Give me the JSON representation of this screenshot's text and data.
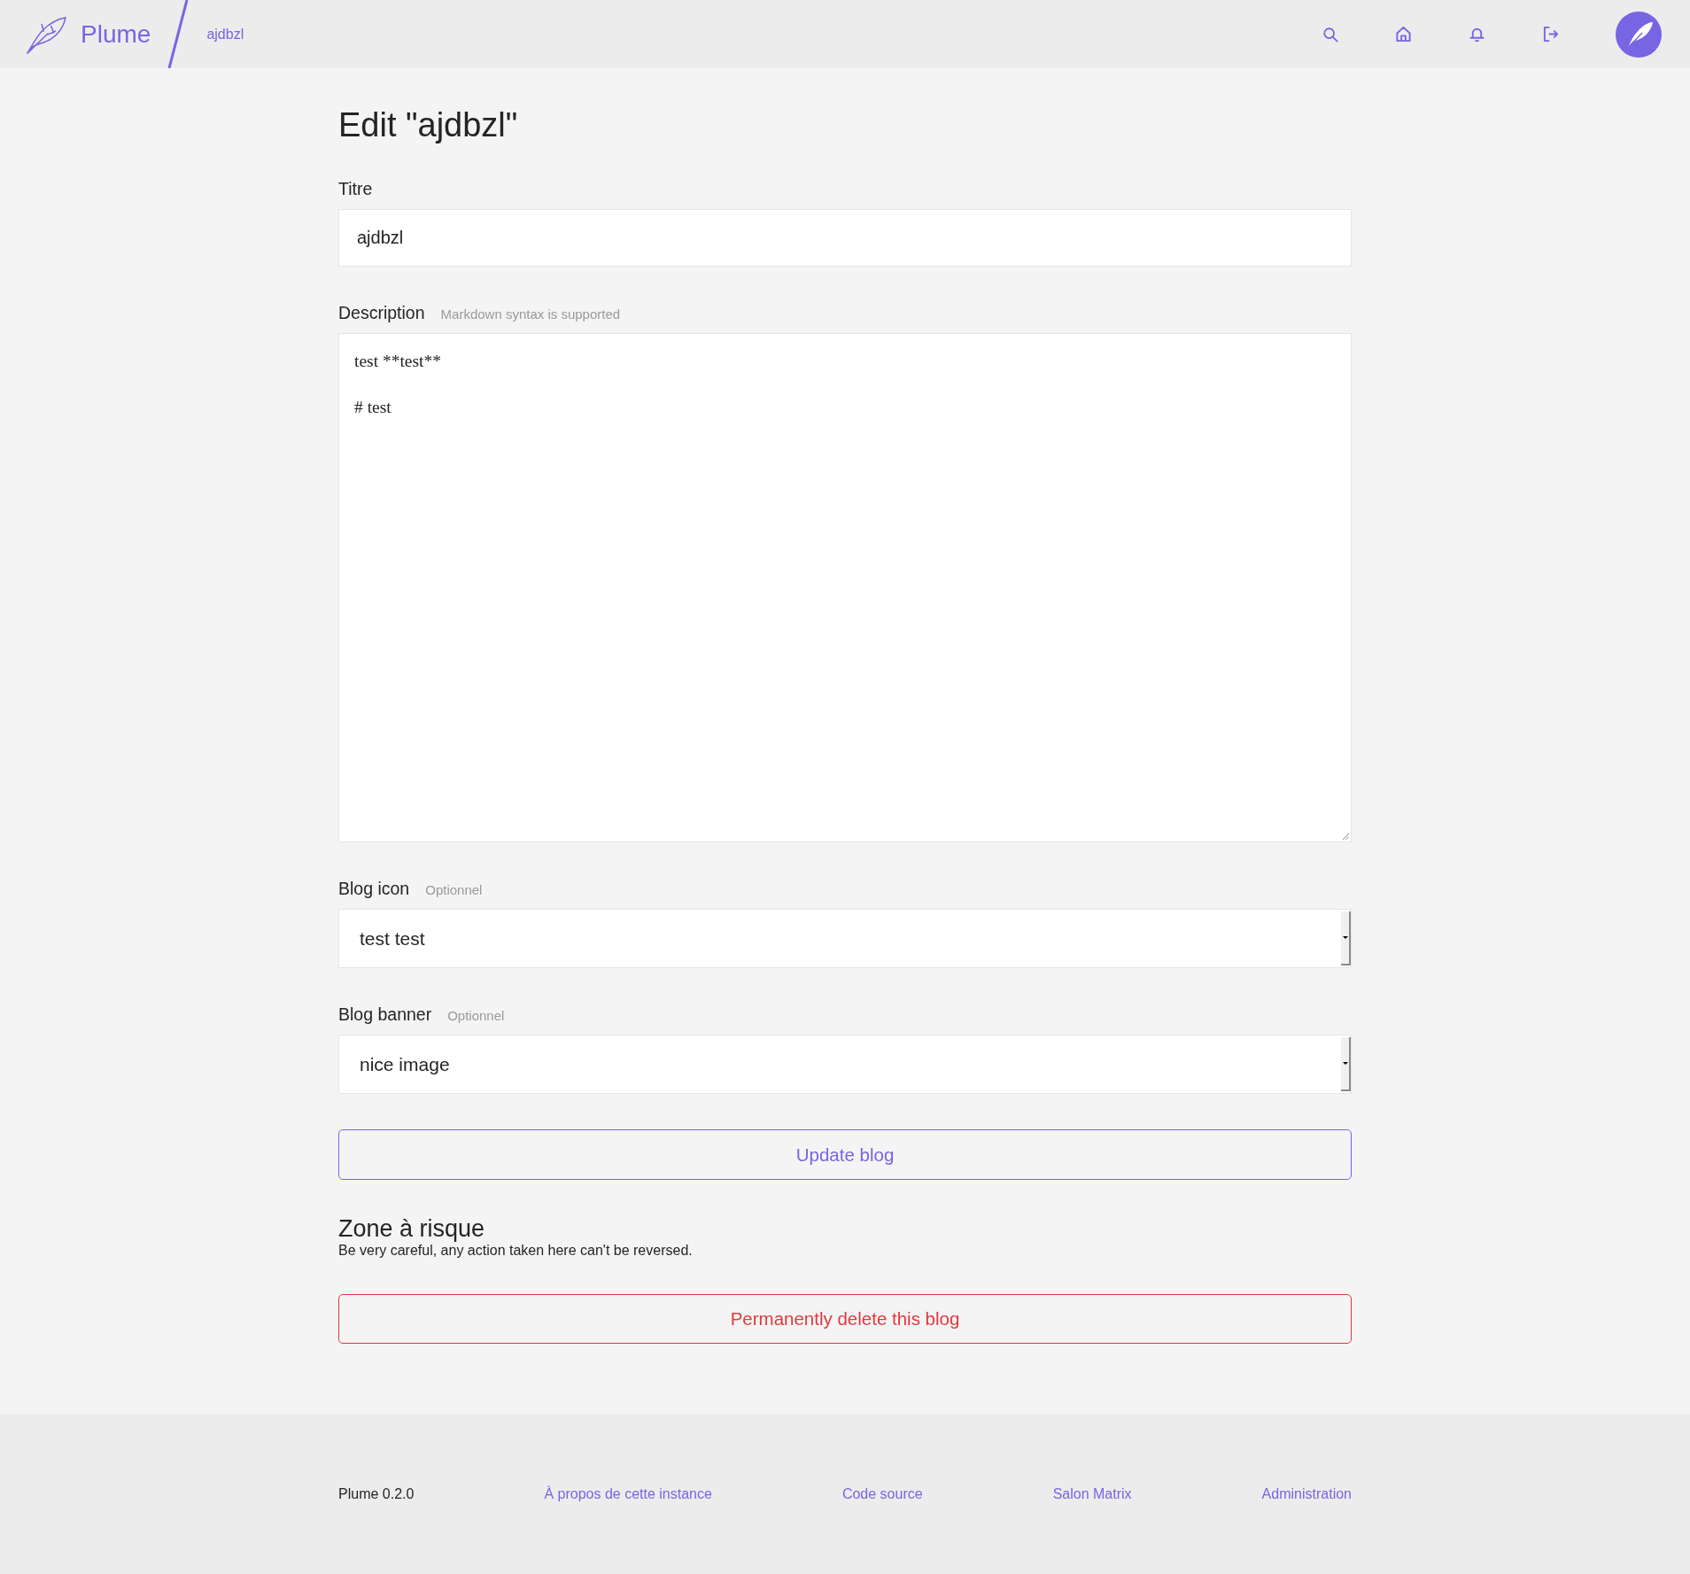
{
  "header": {
    "brand": "Plume",
    "breadcrumb": "ajdbzl"
  },
  "page": {
    "title": "Edit \"ajdbzl\""
  },
  "form": {
    "fields": [
      {
        "kind": "text",
        "label": "Titre",
        "value": "ajdbzl"
      },
      {
        "kind": "textarea",
        "label": "Description",
        "hint": "Markdown syntax is supported",
        "value": "test **test**\n\n# test"
      },
      {
        "kind": "select",
        "label": "Blog icon",
        "hint": "Optionnel",
        "value": "test test"
      },
      {
        "kind": "select",
        "label": "Blog banner",
        "hint": "Optionnel",
        "value": "nice image"
      }
    ],
    "submit": "Update blog"
  },
  "danger_zone": {
    "title": "Zone à risque",
    "warning": "Be very careful, any action taken here can't be reversed.",
    "button": "Permanently delete this blog"
  },
  "footer": {
    "version": "Plume 0.2.0",
    "links": [
      "À propos de cette instance",
      "Code source",
      "Salon Matrix",
      "Administration"
    ]
  }
}
